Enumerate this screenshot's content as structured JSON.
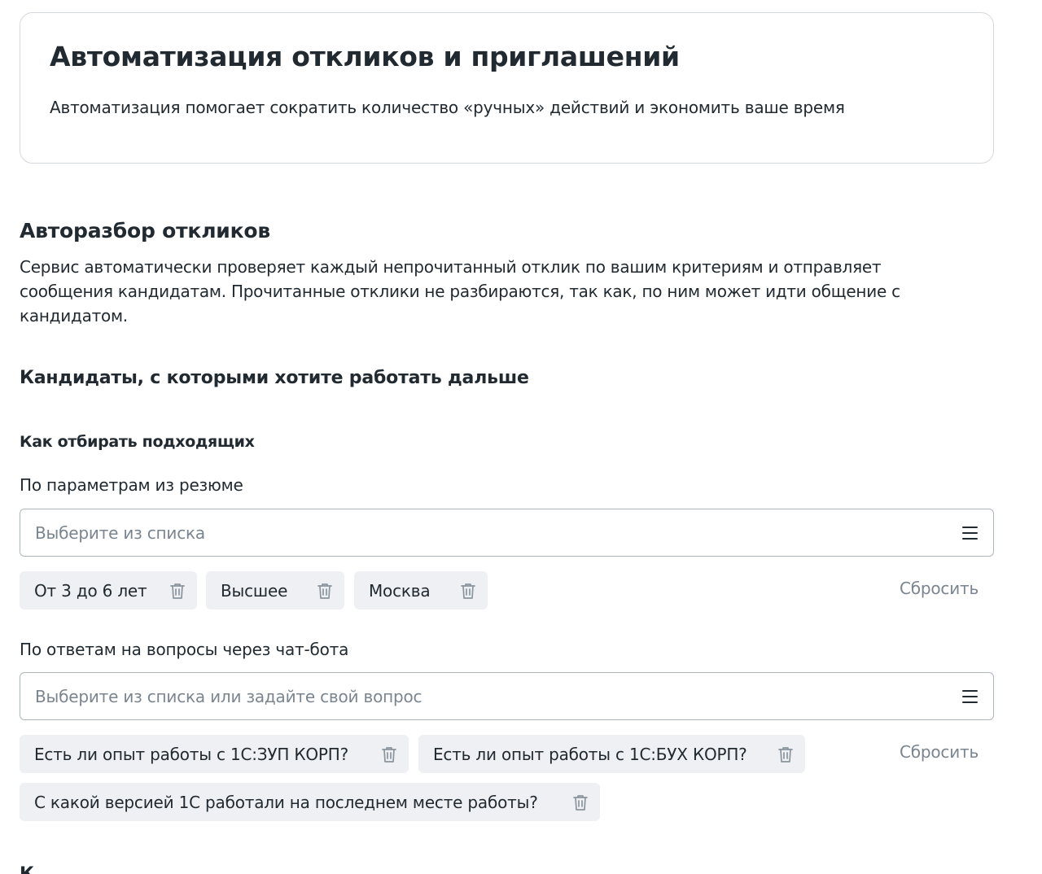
{
  "intro": {
    "title": "Автоматизация откликов и приглашений",
    "subtitle": "Автоматизация помогает сократить количество «ручных» действий и экономить ваше время"
  },
  "section": {
    "title": "Авторазбор откликов",
    "description": "Сервис автоматически проверяет каждый непрочитанный отклик по вашим критериям и отправляет сообщения кандидатам. Прочитанные отклики не разбираются, так как, по ним может идти общение с кандидатом.",
    "candidates_title": "Кандидаты, с которыми хотите работать дальше",
    "criteria_title": "Как отбирать подходящих"
  },
  "resume_filter": {
    "label": "По параметрам из резюме",
    "placeholder": "Выберите из списка",
    "tags": [
      "От 3 до 6 лет",
      "Высшее",
      "Москва"
    ],
    "reset_label": "Сбросить"
  },
  "chatbot_filter": {
    "label": "По ответам на вопросы через чат-бота",
    "placeholder": "Выберите из списка или задайте свой вопрос",
    "tags": [
      "Есть ли опыт работы с 1С:ЗУП КОРП?",
      "Есть ли опыт работы с 1С:БУХ КОРП?",
      "С какой версией 1С работали на последнем месте работы?"
    ],
    "reset_label": "Сбросить"
  },
  "next_section_partial": "К",
  "icons": {
    "select_icon": "menu-lines-icon",
    "tag_remove_icon": "trash-icon"
  }
}
